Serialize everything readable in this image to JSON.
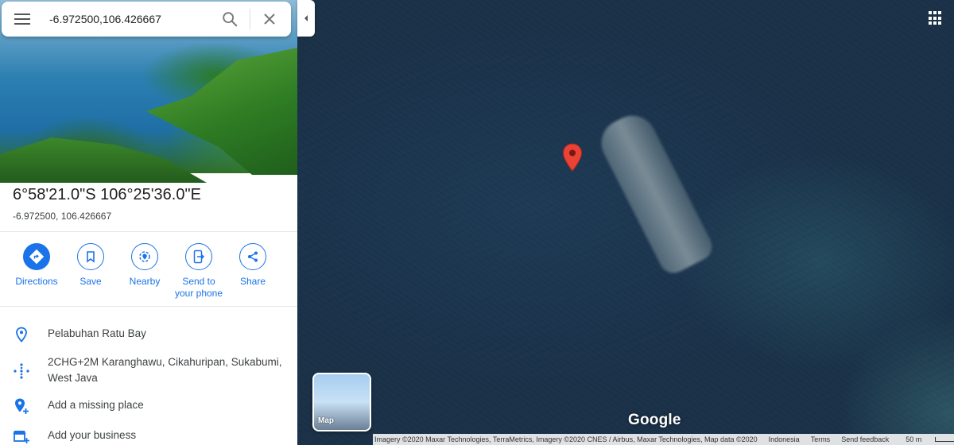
{
  "search": {
    "value": "-6.972500,106.426667"
  },
  "place": {
    "coords_dms": "6°58'21.0\"S 106°25'36.0\"E",
    "coords_decimal": "-6.972500, 106.426667"
  },
  "actions": [
    {
      "label": "Directions",
      "icon": "directions-icon"
    },
    {
      "label": "Save",
      "icon": "bookmark-icon"
    },
    {
      "label": "Nearby",
      "icon": "nearby-icon"
    },
    {
      "label": "Send to your phone",
      "icon": "send-to-phone-icon"
    },
    {
      "label": "Share",
      "icon": "share-icon"
    }
  ],
  "info": [
    {
      "text": "Pelabuhan Ratu Bay",
      "icon": "location-pin-icon"
    },
    {
      "text": "2CHG+2M Karanghawu, Cikahuripan, Sukabumi, West Java",
      "icon": "plus-code-icon"
    },
    {
      "text": "Add a missing place",
      "icon": "add-place-icon"
    },
    {
      "text": "Add your business",
      "icon": "add-business-icon"
    }
  ],
  "map": {
    "layer_label": "Map",
    "logo": "Google",
    "attribution": "Imagery ©2020 Maxar Technologies, TerraMetrics, Imagery ©2020 CNES / Airbus, Maxar Technologies, Map data ©2020",
    "region": "Indonesia",
    "terms": "Terms",
    "feedback": "Send feedback",
    "scale": "50 m"
  },
  "colors": {
    "accent": "#1a73e8",
    "pin": "#ea4335"
  }
}
